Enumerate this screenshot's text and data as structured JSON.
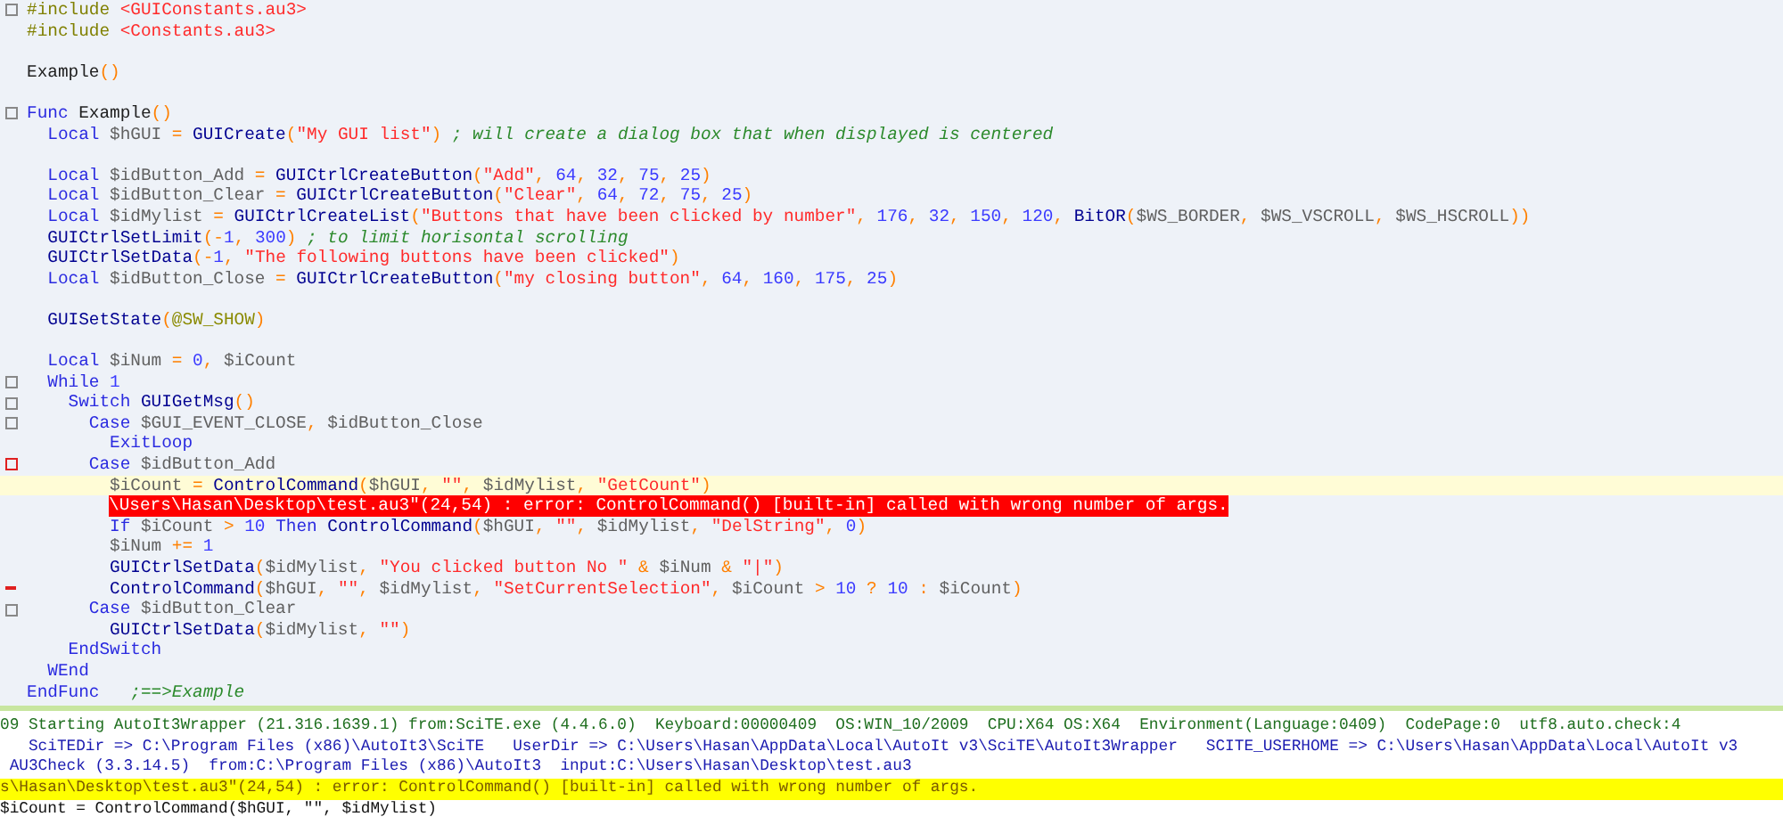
{
  "editor": {
    "lines": [
      {
        "kind": "code",
        "margin": {
          "kind": "fold"
        },
        "tokens": [
          {
            "kind": "pp",
            "text": "#include "
          },
          {
            "kind": "s",
            "text": "<GUIConstants.au3>"
          }
        ]
      },
      {
        "kind": "code",
        "tokens": [
          {
            "kind": "pp",
            "text": "#include "
          },
          {
            "kind": "s",
            "text": "<Constants.au3>"
          }
        ]
      },
      {
        "kind": "blank"
      },
      {
        "kind": "code",
        "tokens": [
          {
            "kind": "p",
            "text": "Example"
          },
          {
            "kind": "o",
            "text": "()"
          }
        ]
      },
      {
        "kind": "blank"
      },
      {
        "kind": "code",
        "margin": {
          "kind": "fold"
        },
        "tokens": [
          {
            "kind": "kw",
            "text": "Func "
          },
          {
            "kind": "p",
            "text": "Example"
          },
          {
            "kind": "o",
            "text": "()"
          }
        ]
      },
      {
        "kind": "code",
        "tokens": [
          {
            "kind": "kw",
            "text": "  Local "
          },
          {
            "kind": "v",
            "text": "$hGUI "
          },
          {
            "kind": "o",
            "text": "= "
          },
          {
            "kind": "fn",
            "text": "GUICreate"
          },
          {
            "kind": "o",
            "text": "("
          },
          {
            "kind": "s",
            "text": "\"My GUI list\""
          },
          {
            "kind": "o",
            "text": ")"
          },
          {
            "kind": "c",
            "text": " ; will create a dialog box that when displayed is centered"
          }
        ]
      },
      {
        "kind": "blank"
      },
      {
        "kind": "code",
        "tokens": [
          {
            "kind": "kw",
            "text": "  Local "
          },
          {
            "kind": "v",
            "text": "$idButton_Add "
          },
          {
            "kind": "o",
            "text": "= "
          },
          {
            "kind": "fn",
            "text": "GUICtrlCreateButton"
          },
          {
            "kind": "o",
            "text": "("
          },
          {
            "kind": "s",
            "text": "\"Add\""
          },
          {
            "kind": "o",
            "text": ", "
          },
          {
            "kind": "n",
            "text": "64"
          },
          {
            "kind": "o",
            "text": ", "
          },
          {
            "kind": "n",
            "text": "32"
          },
          {
            "kind": "o",
            "text": ", "
          },
          {
            "kind": "n",
            "text": "75"
          },
          {
            "kind": "o",
            "text": ", "
          },
          {
            "kind": "n",
            "text": "25"
          },
          {
            "kind": "o",
            "text": ")"
          }
        ]
      },
      {
        "kind": "code",
        "tokens": [
          {
            "kind": "kw",
            "text": "  Local "
          },
          {
            "kind": "v",
            "text": "$idButton_Clear "
          },
          {
            "kind": "o",
            "text": "= "
          },
          {
            "kind": "fn",
            "text": "GUICtrlCreateButton"
          },
          {
            "kind": "o",
            "text": "("
          },
          {
            "kind": "s",
            "text": "\"Clear\""
          },
          {
            "kind": "o",
            "text": ", "
          },
          {
            "kind": "n",
            "text": "64"
          },
          {
            "kind": "o",
            "text": ", "
          },
          {
            "kind": "n",
            "text": "72"
          },
          {
            "kind": "o",
            "text": ", "
          },
          {
            "kind": "n",
            "text": "75"
          },
          {
            "kind": "o",
            "text": ", "
          },
          {
            "kind": "n",
            "text": "25"
          },
          {
            "kind": "o",
            "text": ")"
          }
        ]
      },
      {
        "kind": "code",
        "tokens": [
          {
            "kind": "kw",
            "text": "  Local "
          },
          {
            "kind": "v",
            "text": "$idMylist "
          },
          {
            "kind": "o",
            "text": "= "
          },
          {
            "kind": "fn",
            "text": "GUICtrlCreateList"
          },
          {
            "kind": "o",
            "text": "("
          },
          {
            "kind": "s",
            "text": "\"Buttons that have been clicked by number\""
          },
          {
            "kind": "o",
            "text": ", "
          },
          {
            "kind": "n",
            "text": "176"
          },
          {
            "kind": "o",
            "text": ", "
          },
          {
            "kind": "n",
            "text": "32"
          },
          {
            "kind": "o",
            "text": ", "
          },
          {
            "kind": "n",
            "text": "150"
          },
          {
            "kind": "o",
            "text": ", "
          },
          {
            "kind": "n",
            "text": "120"
          },
          {
            "kind": "o",
            "text": ", "
          },
          {
            "kind": "fn",
            "text": "BitOR"
          },
          {
            "kind": "o",
            "text": "("
          },
          {
            "kind": "v",
            "text": "$WS_BORDER"
          },
          {
            "kind": "o",
            "text": ", "
          },
          {
            "kind": "v",
            "text": "$WS_VSCROLL"
          },
          {
            "kind": "o",
            "text": ", "
          },
          {
            "kind": "v",
            "text": "$WS_HSCROLL"
          },
          {
            "kind": "o",
            "text": "))"
          }
        ]
      },
      {
        "kind": "code",
        "tokens": [
          {
            "kind": "fn",
            "text": "  GUICtrlSetLimit"
          },
          {
            "kind": "o",
            "text": "(-"
          },
          {
            "kind": "n",
            "text": "1"
          },
          {
            "kind": "o",
            "text": ", "
          },
          {
            "kind": "n",
            "text": "300"
          },
          {
            "kind": "o",
            "text": ")"
          },
          {
            "kind": "c",
            "text": " ; to limit horisontal scrolling"
          }
        ]
      },
      {
        "kind": "code",
        "tokens": [
          {
            "kind": "fn",
            "text": "  GUICtrlSetData"
          },
          {
            "kind": "o",
            "text": "(-"
          },
          {
            "kind": "n",
            "text": "1"
          },
          {
            "kind": "o",
            "text": ", "
          },
          {
            "kind": "s",
            "text": "\"The following buttons have been clicked\""
          },
          {
            "kind": "o",
            "text": ")"
          }
        ]
      },
      {
        "kind": "code",
        "tokens": [
          {
            "kind": "kw",
            "text": "  Local "
          },
          {
            "kind": "v",
            "text": "$idButton_Close "
          },
          {
            "kind": "o",
            "text": "= "
          },
          {
            "kind": "fn",
            "text": "GUICtrlCreateButton"
          },
          {
            "kind": "o",
            "text": "("
          },
          {
            "kind": "s",
            "text": "\"my closing button\""
          },
          {
            "kind": "o",
            "text": ", "
          },
          {
            "kind": "n",
            "text": "64"
          },
          {
            "kind": "o",
            "text": ", "
          },
          {
            "kind": "n",
            "text": "160"
          },
          {
            "kind": "o",
            "text": ", "
          },
          {
            "kind": "n",
            "text": "175"
          },
          {
            "kind": "o",
            "text": ", "
          },
          {
            "kind": "n",
            "text": "25"
          },
          {
            "kind": "o",
            "text": ")"
          }
        ]
      },
      {
        "kind": "blank"
      },
      {
        "kind": "code",
        "tokens": [
          {
            "kind": "fn",
            "text": "  GUISetState"
          },
          {
            "kind": "o",
            "text": "("
          },
          {
            "kind": "m",
            "text": "@SW_SHOW"
          },
          {
            "kind": "o",
            "text": ")"
          }
        ]
      },
      {
        "kind": "blank"
      },
      {
        "kind": "code",
        "tokens": [
          {
            "kind": "kw",
            "text": "  Local "
          },
          {
            "kind": "v",
            "text": "$iNum "
          },
          {
            "kind": "o",
            "text": "= "
          },
          {
            "kind": "n",
            "text": "0"
          },
          {
            "kind": "o",
            "text": ", "
          },
          {
            "kind": "v",
            "text": "$iCount"
          }
        ]
      },
      {
        "kind": "code",
        "margin": {
          "kind": "fold"
        },
        "tokens": [
          {
            "kind": "kw",
            "text": "  While "
          },
          {
            "kind": "n",
            "text": "1"
          }
        ]
      },
      {
        "kind": "code",
        "margin": {
          "kind": "fold"
        },
        "tokens": [
          {
            "kind": "kw",
            "text": "    Switch "
          },
          {
            "kind": "fn",
            "text": "GUIGetMsg"
          },
          {
            "kind": "o",
            "text": "()"
          }
        ]
      },
      {
        "kind": "code",
        "margin": {
          "kind": "fold"
        },
        "tokens": [
          {
            "kind": "kw",
            "text": "      Case "
          },
          {
            "kind": "v",
            "text": "$GUI_EVENT_CLOSE"
          },
          {
            "kind": "o",
            "text": ", "
          },
          {
            "kind": "v",
            "text": "$idButton_Close"
          }
        ]
      },
      {
        "kind": "code",
        "tokens": [
          {
            "kind": "kw",
            "text": "        ExitLoop"
          }
        ]
      },
      {
        "kind": "code",
        "margin": {
          "kind": "fold-error"
        },
        "tokens": [
          {
            "kind": "kw",
            "text": "      Case "
          },
          {
            "kind": "v",
            "text": "$idButton_Add"
          }
        ]
      },
      {
        "kind": "code",
        "current": true,
        "tokens": [
          {
            "kind": "v",
            "text": "        $iCount "
          },
          {
            "kind": "o",
            "text": "= "
          },
          {
            "kind": "fn",
            "text": "ControlCommand"
          },
          {
            "kind": "o",
            "text": "("
          },
          {
            "kind": "v",
            "text": "$hGUI"
          },
          {
            "kind": "o",
            "text": ", "
          },
          {
            "kind": "s",
            "text": "\"\""
          },
          {
            "kind": "o",
            "text": ", "
          },
          {
            "kind": "v",
            "text": "$idMylist"
          },
          {
            "kind": "o",
            "text": ", "
          },
          {
            "kind": "s",
            "text": "\"GetCount\""
          },
          {
            "kind": "o",
            "text": ")"
          }
        ]
      },
      {
        "kind": "annotation",
        "text": "\\Users\\Hasan\\Desktop\\test.au3\"(24,54) : error: ControlCommand() [built-in] called with wrong number of args."
      },
      {
        "kind": "code",
        "tokens": [
          {
            "kind": "kw",
            "text": "        If "
          },
          {
            "kind": "v",
            "text": "$iCount "
          },
          {
            "kind": "o",
            "text": "> "
          },
          {
            "kind": "n",
            "text": "10 "
          },
          {
            "kind": "kw",
            "text": "Then "
          },
          {
            "kind": "fn",
            "text": "ControlCommand"
          },
          {
            "kind": "o",
            "text": "("
          },
          {
            "kind": "v",
            "text": "$hGUI"
          },
          {
            "kind": "o",
            "text": ", "
          },
          {
            "kind": "s",
            "text": "\"\""
          },
          {
            "kind": "o",
            "text": ", "
          },
          {
            "kind": "v",
            "text": "$idMylist"
          },
          {
            "kind": "o",
            "text": ", "
          },
          {
            "kind": "s",
            "text": "\"DelString\""
          },
          {
            "kind": "o",
            "text": ", "
          },
          {
            "kind": "n",
            "text": "0"
          },
          {
            "kind": "o",
            "text": ")"
          }
        ]
      },
      {
        "kind": "code",
        "tokens": [
          {
            "kind": "v",
            "text": "        $iNum "
          },
          {
            "kind": "o",
            "text": "+= "
          },
          {
            "kind": "n",
            "text": "1"
          }
        ]
      },
      {
        "kind": "code",
        "tokens": [
          {
            "kind": "fn",
            "text": "        GUICtrlSetData"
          },
          {
            "kind": "o",
            "text": "("
          },
          {
            "kind": "v",
            "text": "$idMylist"
          },
          {
            "kind": "o",
            "text": ", "
          },
          {
            "kind": "s",
            "text": "\"You clicked button No \""
          },
          {
            "kind": "o",
            "text": " & "
          },
          {
            "kind": "v",
            "text": "$iNum"
          },
          {
            "kind": "o",
            "text": " & "
          },
          {
            "kind": "s",
            "text": "\"|\""
          },
          {
            "kind": "o",
            "text": ")"
          }
        ]
      },
      {
        "kind": "code",
        "margin": {
          "kind": "error"
        },
        "tokens": [
          {
            "kind": "fn",
            "text": "        ControlCommand"
          },
          {
            "kind": "o",
            "text": "("
          },
          {
            "kind": "v",
            "text": "$hGUI"
          },
          {
            "kind": "o",
            "text": ", "
          },
          {
            "kind": "s",
            "text": "\"\""
          },
          {
            "kind": "o",
            "text": ", "
          },
          {
            "kind": "v",
            "text": "$idMylist"
          },
          {
            "kind": "o",
            "text": ", "
          },
          {
            "kind": "s",
            "text": "\"SetCurrentSelection\""
          },
          {
            "kind": "o",
            "text": ", "
          },
          {
            "kind": "v",
            "text": "$iCount "
          },
          {
            "kind": "o",
            "text": "> "
          },
          {
            "kind": "n",
            "text": "10 "
          },
          {
            "kind": "o",
            "text": "? "
          },
          {
            "kind": "n",
            "text": "10 "
          },
          {
            "kind": "o",
            "text": ": "
          },
          {
            "kind": "v",
            "text": "$iCount"
          },
          {
            "kind": "o",
            "text": ")"
          }
        ]
      },
      {
        "kind": "code",
        "margin": {
          "kind": "fold"
        },
        "tokens": [
          {
            "kind": "kw",
            "text": "      Case "
          },
          {
            "kind": "v",
            "text": "$idButton_Clear"
          }
        ]
      },
      {
        "kind": "code",
        "tokens": [
          {
            "kind": "fn",
            "text": "        GUICtrlSetData"
          },
          {
            "kind": "o",
            "text": "("
          },
          {
            "kind": "v",
            "text": "$idMylist"
          },
          {
            "kind": "o",
            "text": ", "
          },
          {
            "kind": "s",
            "text": "\"\""
          },
          {
            "kind": "o",
            "text": ")"
          }
        ]
      },
      {
        "kind": "code",
        "tokens": [
          {
            "kind": "kw",
            "text": "    EndSwitch"
          }
        ]
      },
      {
        "kind": "code",
        "tokens": [
          {
            "kind": "kw",
            "text": "  WEnd"
          }
        ]
      },
      {
        "kind": "code",
        "tokens": [
          {
            "kind": "kw",
            "text": "EndFunc"
          },
          {
            "kind": "c",
            "text": "   ;==>Example"
          }
        ]
      }
    ]
  },
  "output": {
    "lines": [
      {
        "kind": "info",
        "text": "09 Starting AutoIt3Wrapper (21.316.1639.1) from:SciTE.exe (4.4.6.0)  Keyboard:00000409  OS:WIN_10/2009  CPU:X64 OS:X64  Environment(Language:0409)  CodePage:0  utf8.auto.check:4"
      },
      {
        "kind": "path",
        "text": "   SciTEDir => C:\\Program Files (x86)\\AutoIt3\\SciTE   UserDir => C:\\Users\\Hasan\\AppData\\Local\\AutoIt v3\\SciTE\\AutoIt3Wrapper   SCITE_USERHOME => C:\\Users\\Hasan\\AppData\\Local\\AutoIt v3"
      },
      {
        "kind": "path",
        "text": " AU3Check (3.3.14.5)  from:C:\\Program Files (x86)\\AutoIt3  input:C:\\Users\\Hasan\\Desktop\\test.au3"
      },
      {
        "kind": "error",
        "text": "s\\Hasan\\Desktop\\test.au3\"(24,54) : error: ControlCommand() [built-in] called with wrong number of args."
      },
      {
        "kind": "plain",
        "text": "$iCount = ControlCommand($hGUI, \"\", $idMylist)"
      }
    ]
  }
}
